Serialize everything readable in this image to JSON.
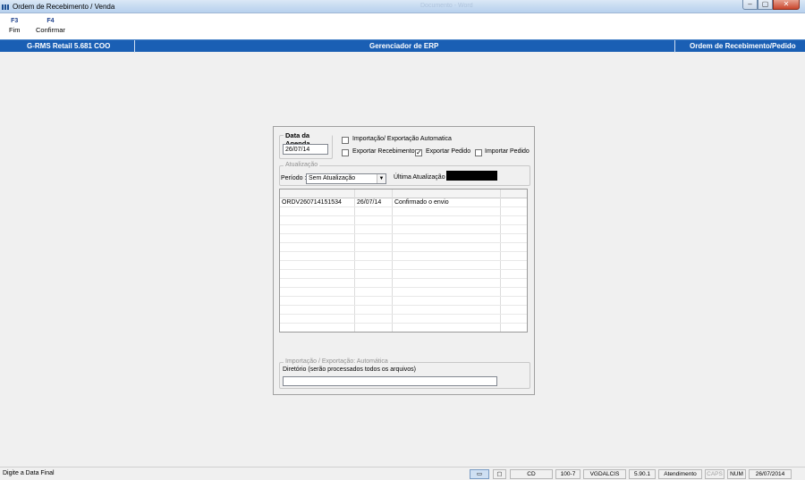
{
  "window": {
    "title": "Ordem de Recebimento / Venda",
    "ghost_title": "Documento - Word",
    "buttons": {
      "minimize": "–",
      "maximize": "▢",
      "close": "✕"
    }
  },
  "toolbar": {
    "items": [
      {
        "key": "F3",
        "label": "Fim"
      },
      {
        "key": "F4",
        "label": "Confirmar"
      }
    ]
  },
  "header": {
    "left": "G-RMS Retail 5.681 COO",
    "center": "Gerenciador de ERP",
    "right": "Ordem de Recebimento/Pedido"
  },
  "agenda": {
    "legend": "Data da Agenda",
    "date_value": "26/07/14"
  },
  "options": {
    "auto_import_export": {
      "label": "Importação/ Exportação Automatica",
      "checked": false
    },
    "export_recebimento": {
      "label": "Exportar Recebimento",
      "checked": false
    },
    "export_pedido": {
      "label": "Exportar Pedido",
      "checked": true
    },
    "import_pedido": {
      "label": "Importar Pedido",
      "checked": false
    }
  },
  "atualizacao": {
    "legend": "Atualização",
    "periodo_label": "Período :",
    "periodo_value": "Sem Atualização",
    "ultima_label": "Última Atualização :"
  },
  "grid": {
    "rows": [
      {
        "code": "ORDV260714151534",
        "date": "26/07/14",
        "status": "Confirmado o envio"
      }
    ]
  },
  "auto": {
    "legend": "Importação / Exportação: Automática",
    "dir_label": "Diretório (serão processados todos os arquivos)",
    "dir_value": ""
  },
  "status": {
    "message": "Digite a Data Final",
    "cd": "CD",
    "code": "100-7",
    "user": "VGDALCIS",
    "version": "5.90.1",
    "mode": "Atendimento",
    "caps": "CAPS",
    "num": "NUM",
    "date": "26/07/2014"
  }
}
